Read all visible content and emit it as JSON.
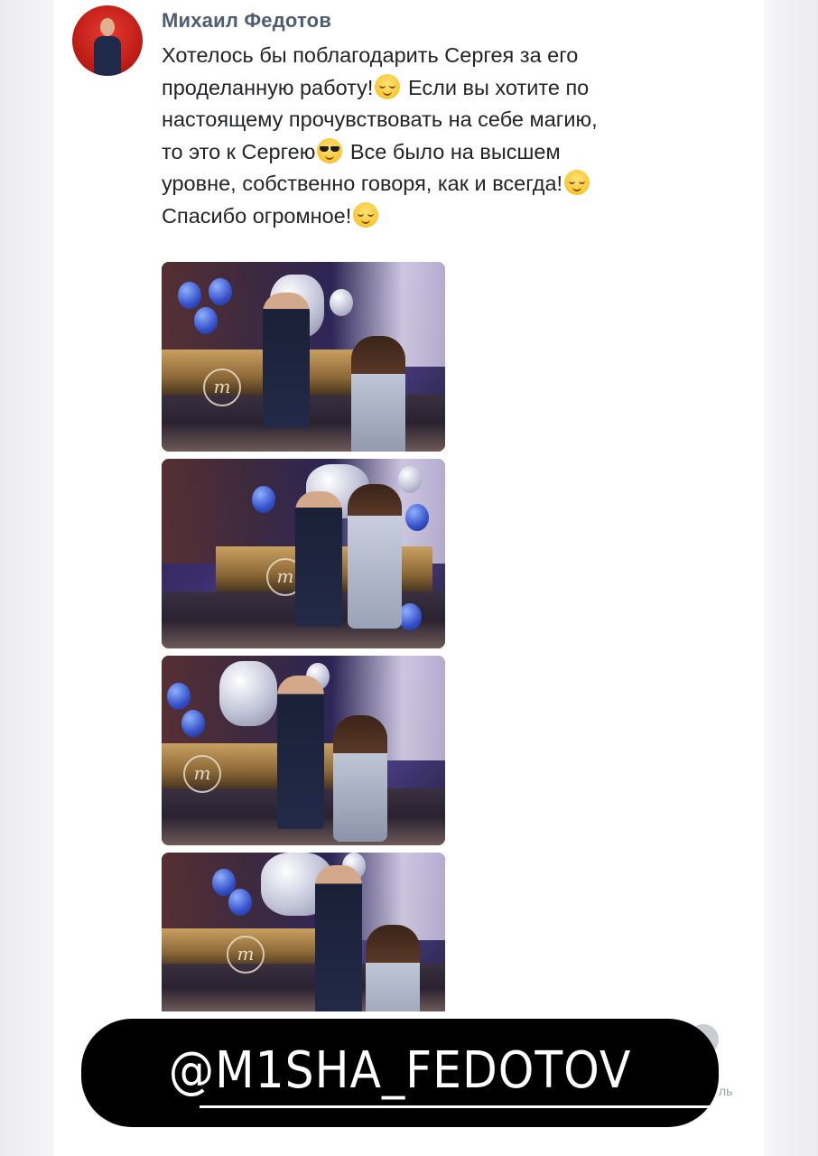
{
  "post": {
    "author": "Михаил Федотов",
    "lines": [
      "Хотелось бы поблагодарить Сергея за его",
      "проделанную работу!",
      "Если вы хотите по",
      "настоящему прочувствовать на себе магию,",
      "то это к Сергею",
      "Все было на высшем",
      "уровне, собственно говоря, как и всегда!",
      "Спасибо огромное!"
    ],
    "emoji": [
      "relieved-face",
      "sunglasses-face",
      "smirking-face",
      "smiling-face"
    ],
    "photos": [
      {
        "logo_letter": "m"
      },
      {
        "logo_letter": "m"
      },
      {
        "logo_letter": "m"
      },
      {
        "logo_letter": "m"
      }
    ]
  },
  "overlay": {
    "handle": "@M1SHA_FEDOTOV"
  },
  "footer": {
    "partial_text": "ль"
  },
  "colors": {
    "author": "#4f5d73",
    "text": "#222428",
    "overlay_bg": "#000000",
    "overlay_text": "#ffffff"
  }
}
